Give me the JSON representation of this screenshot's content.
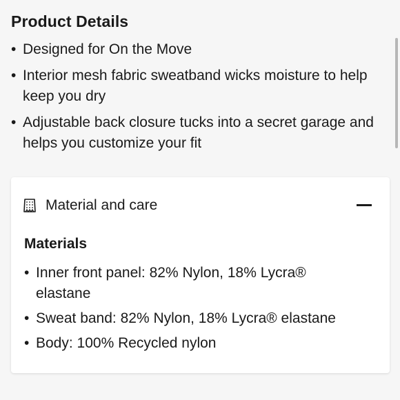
{
  "product_details": {
    "title": "Product Details",
    "bullets": [
      "Designed for On the Move",
      "Interior mesh fabric sweatband wicks moisture to help keep you dry",
      "Adjustable back closure tucks into a secret garage and helps you customize your fit"
    ]
  },
  "accordion": {
    "title": "Material and care",
    "icon": "fabric-swatch-icon",
    "expanded_icon": "minus-icon",
    "materials_heading": "Materials",
    "materials": [
      "Inner front panel: 82% Nylon, 18% Lycra® elastane",
      "Sweat band: 82% Nylon, 18% Lycra® elastane",
      "Body: 100% Recycled nylon"
    ]
  },
  "colors": {
    "background": "#f6f6f6",
    "card": "#ffffff",
    "text": "#1a1a1a",
    "scrollbar": "#b6b6b6"
  }
}
